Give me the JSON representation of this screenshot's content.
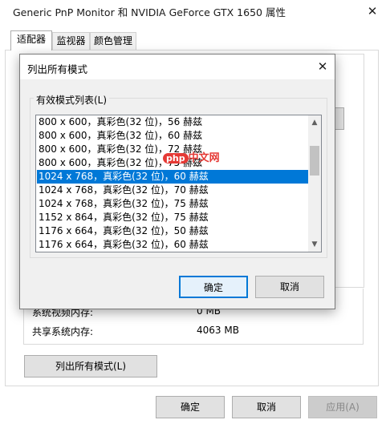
{
  "window": {
    "title": "Generic PnP Monitor 和 NVIDIA GeForce GTX 1650 属性",
    "close_glyph": "✕",
    "tabs": [
      "适配器",
      "监视器",
      "颜色管理"
    ],
    "memory": {
      "video_label": "系统视频内存:",
      "video_value": "0 MB",
      "shared_label": "共享系统内存:",
      "shared_value": "4063 MB"
    },
    "list_modes_button": "列出所有模式(L)",
    "ok_button": "确定",
    "cancel_button": "取消",
    "apply_button": "应用(A)"
  },
  "dialog": {
    "title": "列出所有模式",
    "close_glyph": "✕",
    "group_label": "有效模式列表(L)",
    "selected_index": 4,
    "modes": [
      "800 x 600，真彩色(32 位)，56 赫兹",
      "800 x 600，真彩色(32 位)，60 赫兹",
      "800 x 600，真彩色(32 位)，72 赫兹",
      "800 x 600，真彩色(32 位)，75 赫兹",
      "1024 x 768，真彩色(32 位)，60 赫兹",
      "1024 x 768，真彩色(32 位)，70 赫兹",
      "1024 x 768，真彩色(32 位)，75 赫兹",
      "1152 x 864，真彩色(32 位)，75 赫兹",
      "1176 x 664，真彩色(32 位)，50 赫兹",
      "1176 x 664，真彩色(32 位)，60 赫兹"
    ],
    "ok_button": "确定",
    "cancel_button": "取消"
  },
  "watermark": {
    "badge": "php",
    "text": "中文网"
  },
  "colors": {
    "selection": "#0078d7",
    "default_button_border": "#0078d7",
    "watermark": "#e53935"
  }
}
